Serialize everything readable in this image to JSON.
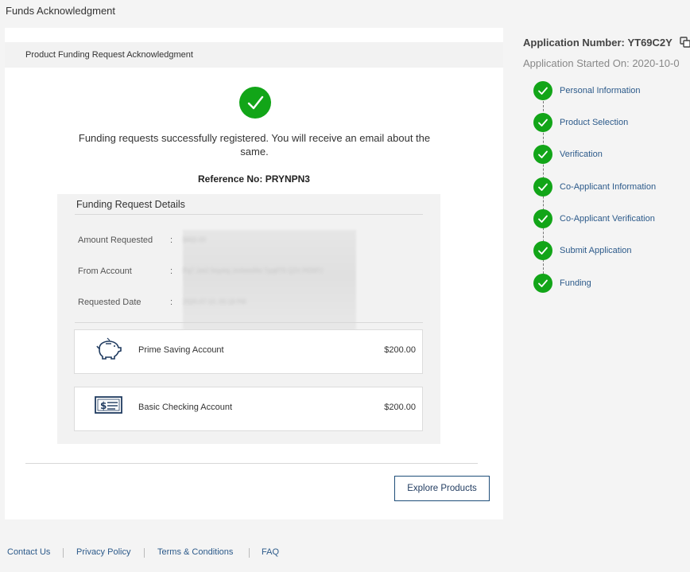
{
  "page": {
    "title": "Funds Acknowledgment"
  },
  "card": {
    "header_title": "Product Funding Request Acknowledgment",
    "success_message": "Funding requests successfully registered. You will receive an email about the same.",
    "reference_label": "Reference No:",
    "reference_value": "PRYNPN3",
    "details": {
      "title": "Funding Request Details",
      "rows": [
        {
          "label": "Amount Requested",
          "colon": ":",
          "value": "$400.00"
        },
        {
          "label": "From Account",
          "colon": ":",
          "value": "Pq7 Jzk2 Nvp4sj JmNwsRkt Tpq8T9 Q2X PERPJ"
        },
        {
          "label": "Requested Date",
          "colon": ":",
          "value": "2020-07-10, 05:18 PM"
        }
      ],
      "accounts": [
        {
          "name": "Prime Saving Account",
          "amount": "$200.00",
          "icon": "piggy-bank-icon"
        },
        {
          "name": "Basic Checking Account",
          "amount": "$200.00",
          "icon": "check-icon"
        }
      ]
    },
    "explore_button": "Explore Products"
  },
  "sidebar": {
    "application_number_label": "Application Number:",
    "application_number": "YT69C2Y",
    "application_started_label": "Application Started On:",
    "application_started": "2020-10-0",
    "steps": [
      {
        "label": "Personal Information",
        "status": "complete"
      },
      {
        "label": "Product Selection",
        "status": "complete"
      },
      {
        "label": "Verification",
        "status": "complete"
      },
      {
        "label": "Co-Applicant Information",
        "status": "complete"
      },
      {
        "label": "Co-Applicant Verification",
        "status": "complete"
      },
      {
        "label": "Submit Application",
        "status": "complete"
      },
      {
        "label": "Funding",
        "status": "complete"
      }
    ]
  },
  "footer": {
    "links": [
      "Contact Us",
      "Privacy Policy",
      "Terms & Conditions",
      "FAQ"
    ]
  },
  "colors": {
    "success_green": "#12a518",
    "link_blue": "#2c5a8a",
    "button_border": "#1f4e79"
  }
}
